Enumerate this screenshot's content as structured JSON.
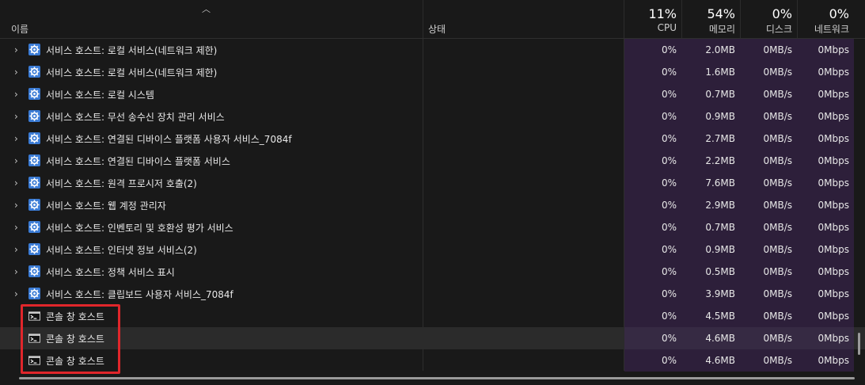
{
  "header": {
    "name_label": "이름",
    "status_label": "상태",
    "cpu": {
      "percent": "11%",
      "label": "CPU"
    },
    "memory": {
      "percent": "54%",
      "label": "메모리"
    },
    "disk": {
      "percent": "0%",
      "label": "디스크"
    },
    "network": {
      "percent": "0%",
      "label": "네트워크"
    }
  },
  "rows": [
    {
      "name": "서비스 호스트: 로컬 서비스(네트워크 제한)",
      "cpu": "0%",
      "mem": "2.0MB",
      "disk": "0MB/s",
      "net": "0Mbps"
    },
    {
      "name": "서비스 호스트: 로컬 서비스(네트워크 제한)",
      "cpu": "0%",
      "mem": "1.6MB",
      "disk": "0MB/s",
      "net": "0Mbps"
    },
    {
      "name": "서비스 호스트: 로컬 시스템",
      "cpu": "0%",
      "mem": "0.7MB",
      "disk": "0MB/s",
      "net": "0Mbps"
    },
    {
      "name": "서비스 호스트: 무선 송수신 장치 관리 서비스",
      "cpu": "0%",
      "mem": "0.9MB",
      "disk": "0MB/s",
      "net": "0Mbps"
    },
    {
      "name": "서비스 호스트: 연결된 디바이스 플랫폼 사용자 서비스_7084f",
      "cpu": "0%",
      "mem": "2.7MB",
      "disk": "0MB/s",
      "net": "0Mbps"
    },
    {
      "name": "서비스 호스트: 연결된 디바이스 플랫폼 서비스",
      "cpu": "0%",
      "mem": "2.2MB",
      "disk": "0MB/s",
      "net": "0Mbps"
    },
    {
      "name": "서비스 호스트: 원격 프로시저 호출(2)",
      "cpu": "0%",
      "mem": "7.6MB",
      "disk": "0MB/s",
      "net": "0Mbps"
    },
    {
      "name": "서비스 호스트: 웹 계정 관리자",
      "cpu": "0%",
      "mem": "2.9MB",
      "disk": "0MB/s",
      "net": "0Mbps"
    },
    {
      "name": "서비스 호스트: 인벤토리 및 호환성 평가 서비스",
      "cpu": "0%",
      "mem": "0.7MB",
      "disk": "0MB/s",
      "net": "0Mbps"
    },
    {
      "name": "서비스 호스트: 인터넷 정보 서비스(2)",
      "cpu": "0%",
      "mem": "0.9MB",
      "disk": "0MB/s",
      "net": "0Mbps"
    },
    {
      "name": "서비스 호스트: 정책 서비스 표시",
      "cpu": "0%",
      "mem": "0.5MB",
      "disk": "0MB/s",
      "net": "0Mbps"
    },
    {
      "name": "서비스 호스트: 클립보드 사용자 서비스_7084f",
      "cpu": "0%",
      "mem": "3.9MB",
      "disk": "0MB/s",
      "net": "0Mbps"
    },
    {
      "name": "콘솔 창 호스트",
      "cpu": "0%",
      "mem": "4.5MB",
      "disk": "0MB/s",
      "net": "0Mbps"
    },
    {
      "name": "콘솔 창 호스트",
      "cpu": "0%",
      "mem": "4.6MB",
      "disk": "0MB/s",
      "net": "0Mbps"
    },
    {
      "name": "콘솔 창 호스트",
      "cpu": "0%",
      "mem": "4.6MB",
      "disk": "0MB/s",
      "net": "0Mbps"
    }
  ],
  "colors": {
    "background": "#191919",
    "metric_column": "#2d1f3a",
    "highlight_box": "#e0262b"
  },
  "icons": {
    "service": "gear-icon",
    "console": "console-icon",
    "expand": "chevron-right-icon",
    "sort": "sort-up-icon"
  }
}
